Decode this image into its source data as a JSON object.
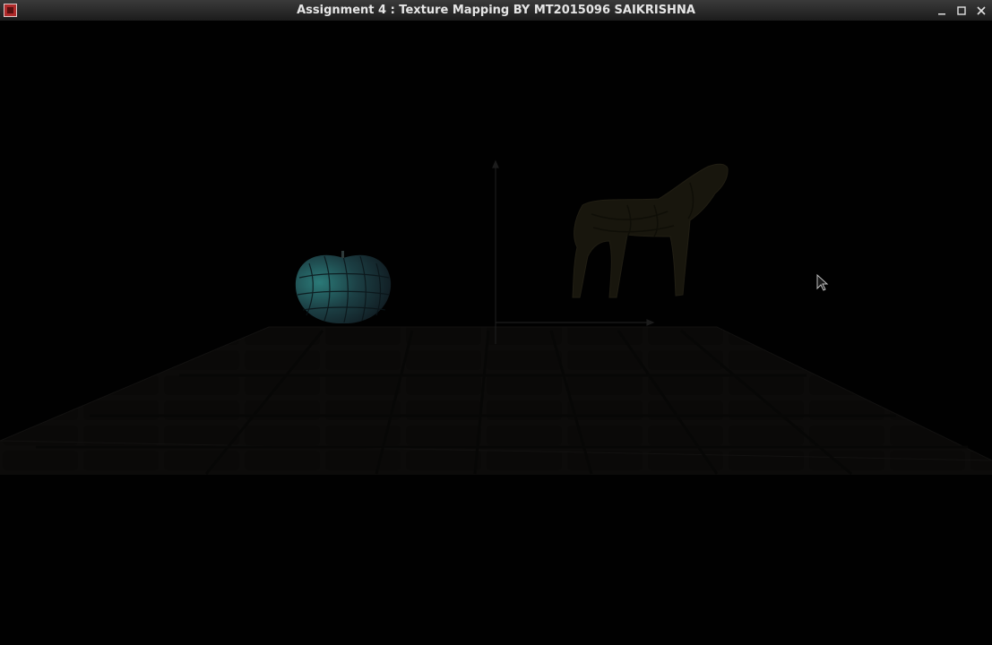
{
  "window": {
    "title": "Assignment 4 : Texture Mapping BY MT2015096 SAIKRISHNA",
    "controls": {
      "minimize_icon": "minimize-icon",
      "maximize_icon": "maximize-icon",
      "close_icon": "close-icon"
    }
  },
  "scene": {
    "background_color": "#010101",
    "floor_color": "#0c0b09",
    "apple_color": "#2a7070",
    "horse_color": "#1a180e",
    "axis_color": "#1c1c1c",
    "cursor_icon": "mouse-pointer-icon"
  }
}
